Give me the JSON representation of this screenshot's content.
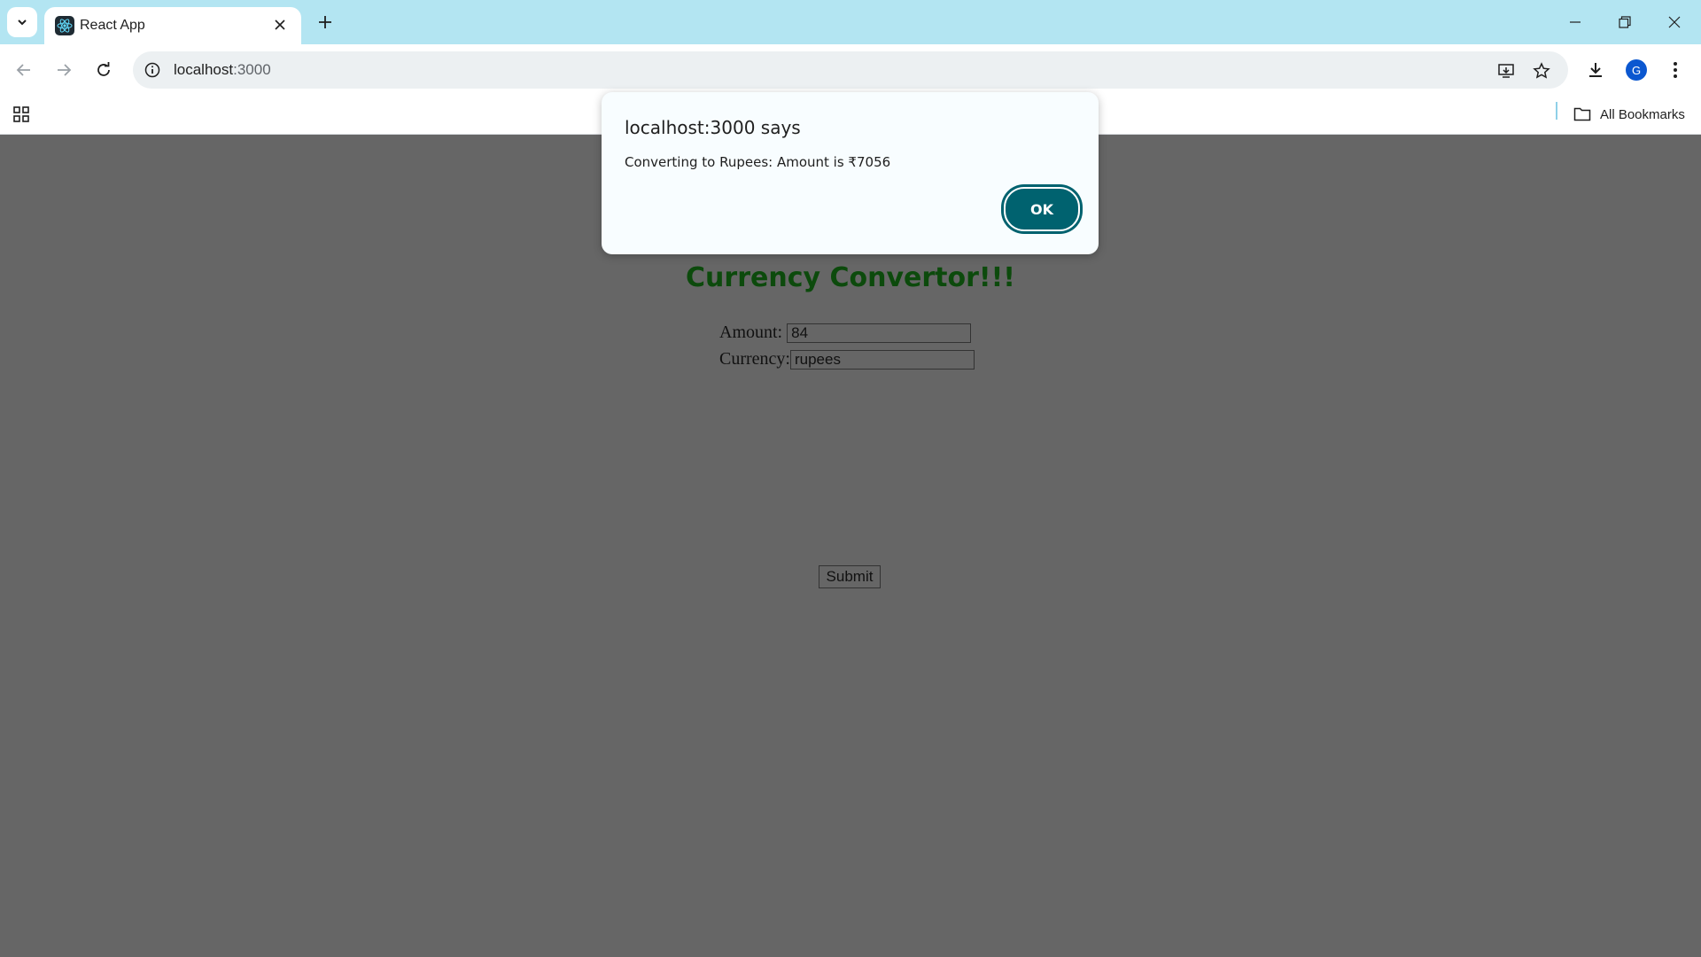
{
  "browser": {
    "tab_title": "React App",
    "url_host": "localhost",
    "url_port": ":3000",
    "bookmarks_label": "All Bookmarks",
    "profile_initial": "G"
  },
  "app": {
    "title": "Currency Convertor!!!",
    "amount_label": "Amount:",
    "amount_value": "84",
    "currency_label": "Currency:",
    "currency_value": "rupees",
    "submit_label": "Submit"
  },
  "alert": {
    "title": "localhost:3000 says",
    "message": "Converting to Rupees: Amount is ₹7056",
    "ok_label": "OK"
  },
  "colors": {
    "tabstrip": "#b3e5f2",
    "page_overlay": "#666666",
    "title_green": "#0c4a0c",
    "ok_button": "#00626f"
  }
}
